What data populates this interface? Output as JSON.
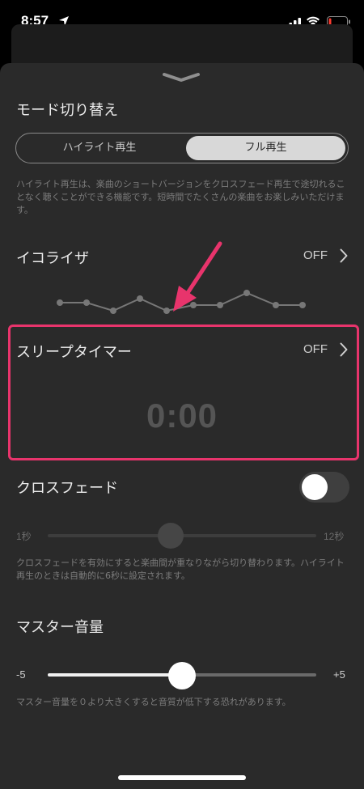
{
  "status_bar": {
    "time": "8:57",
    "battery_level": 0.1
  },
  "mode_switch": {
    "title": "モード切り替え",
    "options": [
      "ハイライト再生",
      "フル再生"
    ],
    "selected": "フル再生",
    "note": "ハイライト再生は、楽曲のショートバージョンをクロスフェード再生で途切れることなく聴くことができる機能です。短時間でたくさんの楽曲をお楽しみいただけます。"
  },
  "equalizer": {
    "title": "イコライザ",
    "value": "OFF"
  },
  "sleep_timer": {
    "title": "スリープタイマー",
    "value": "OFF",
    "display": "0:00"
  },
  "crossfade": {
    "title": "クロスフェード",
    "enabled": false,
    "min_label": "1秒",
    "max_label": "12秒",
    "slider_value": 6,
    "note": "クロスフェードを有効にすると楽曲間が重なりながら切り替わります。ハイライト再生のときは自動的に6秒に設定されます。"
  },
  "master_volume": {
    "title": "マスター音量",
    "min_label": "-5",
    "max_label": "+5",
    "value": 0,
    "note": "マスター音量を０より大きくすると音質が低下する恐れがあります。"
  },
  "colors": {
    "highlight": "#e8346c",
    "accent": "#e8346c",
    "sheet": "#2a2a2a"
  }
}
